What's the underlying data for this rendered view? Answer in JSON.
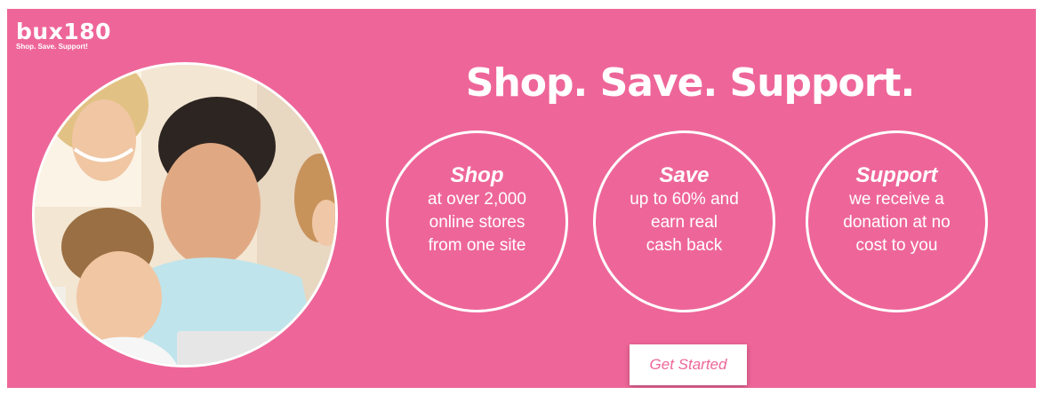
{
  "brand": {
    "name": "bux180",
    "tagline": "Shop. Save. Support!"
  },
  "headline": "Shop. Save. Support.",
  "features": [
    {
      "title": "Shop",
      "body": "at over 2,000\nonline stores\nfrom one site",
      "icon": ""
    },
    {
      "title": "Save",
      "body": "up to 60% and\nearn real\ncash back"
    },
    {
      "title": "Support",
      "body": "we receive a\ndonation at no\ncost to you"
    }
  ],
  "cta": {
    "label": "Get Started"
  },
  "colors": {
    "background": "#ee6699",
    "text": "#ffffff",
    "button_text": "#ee6699"
  }
}
